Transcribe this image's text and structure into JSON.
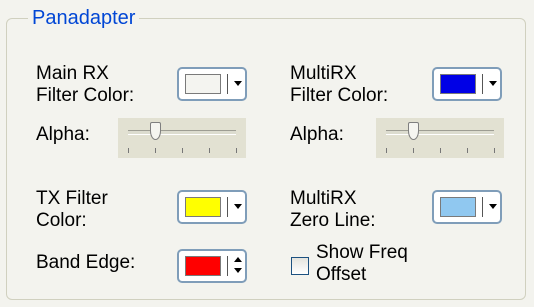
{
  "group": {
    "title": "Panadapter"
  },
  "main_rx": {
    "label_line1": "Main RX",
    "label_line2": "Filter Color:",
    "color": "#f4f4f0"
  },
  "multi_rx": {
    "label_line1": "MultiRX",
    "label_line2": "Filter Color:",
    "color": "#0000e6"
  },
  "alpha_left": {
    "label": "Alpha:",
    "value_fraction": 0.25
  },
  "alpha_right": {
    "label": "Alpha:",
    "value_fraction": 0.25
  },
  "tx_filter": {
    "label_line1": "TX Filter",
    "label_line2": "Color:",
    "color": "#ffff00"
  },
  "multi_rx_zero": {
    "label_line1": "MultiRX",
    "label_line2": "Zero Line:",
    "color": "#90c8f0"
  },
  "band_edge": {
    "label": "Band Edge:",
    "color": "#ff0000"
  },
  "show_freq_offset": {
    "label_line1": "Show Freq",
    "label_line2": "Offset",
    "checked": false
  }
}
